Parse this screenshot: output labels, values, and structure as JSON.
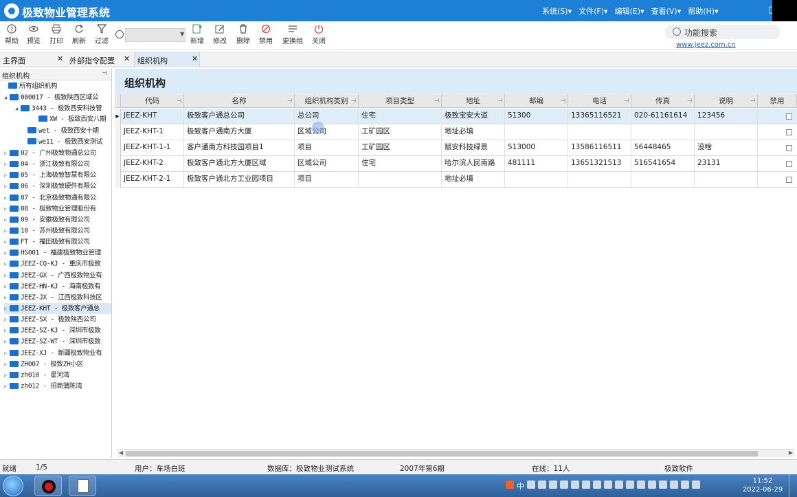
{
  "app": {
    "title": "极致物业管理系统"
  },
  "menus": [
    "系统(S)▾",
    "文件(F)▾",
    "编辑(E)▾",
    "查看(V)▾",
    "帮助(H)▾"
  ],
  "toolbar": {
    "help": "帮助",
    "preview": "预览",
    "print": "打印",
    "refresh": "刷新",
    "filter": "过滤",
    "new": "新增",
    "edit": "修改",
    "delete": "删除",
    "disable": "禁用",
    "change_group": "更换组",
    "close": "关闭"
  },
  "func_search": {
    "placeholder": "功能搜索",
    "link": "www.jeez.com.cn"
  },
  "tabs": [
    {
      "label": "主界面"
    },
    {
      "label": "外部指令配置"
    },
    {
      "label": "组织机构"
    }
  ],
  "tree": {
    "header": "组织机构",
    "items": [
      {
        "label": "所有组织机构"
      },
      {
        "label": "000017 - 极致陕西区域公"
      },
      {
        "label": "3443 - 极致西安科技管"
      },
      {
        "label": "XW - 极致西安八期"
      },
      {
        "label": "wet - 极致西安十期"
      },
      {
        "label": "we11 - 极致西安测试"
      },
      {
        "label": "02 - 广州极致物通总公司"
      },
      {
        "label": "04 - 浙江极致有限公司"
      },
      {
        "label": "05 - 上海极致智慧有限公"
      },
      {
        "label": "06 - 深圳极致硬件有限公"
      },
      {
        "label": "07 - 北京极致物通有限公"
      },
      {
        "label": "08 - 极致物业管理股份有"
      },
      {
        "label": "09 - 安徽极致有限公司"
      },
      {
        "label": "10 - 苏州极致有限公司"
      },
      {
        "label": "FT - 福田极致有限公司"
      },
      {
        "label": "HS001 - 福建极致物业管理"
      },
      {
        "label": "JEEZ-CQ-KJ - 重庆市极致"
      },
      {
        "label": "JEEZ-GX - 广西极致物业有"
      },
      {
        "label": "JEEZ-HN-KJ - 海南极致有"
      },
      {
        "label": "JEEZ-JX - 江西极致科技区"
      },
      {
        "label": "JEEZ-KHT - 极致客户通总"
      },
      {
        "label": "JEEZ-SX - 极致陕西公司"
      },
      {
        "label": "JEEZ-SZ-KJ - 深圳市极致"
      },
      {
        "label": "JEEZ-SZ-WT - 深圳市极致"
      },
      {
        "label": "JEEZ-XJ - 新疆极致物业有"
      },
      {
        "label": "ZH007 - 极致ZH小区"
      },
      {
        "label": "zh010 - 星河湾"
      },
      {
        "label": "zh012 - 招商蒲陈湾"
      }
    ]
  },
  "main": {
    "heading": "组织机构"
  },
  "grid": {
    "columns": [
      "代码",
      "名称",
      "组织机构类别",
      "项目类型",
      "地址",
      "邮编",
      "电话",
      "传真",
      "说明",
      "禁用"
    ],
    "rows": [
      [
        "JEEZ-KHT",
        "极致客户通总公司",
        "总公司",
        "住宅",
        "极致宝安大道",
        "51300",
        "13365116521",
        "020-61161614",
        "123456"
      ],
      [
        "JEEZ-KHT-1",
        "极致客户通南方大厦",
        "区域公司",
        "工矿园区",
        "地址必填",
        "",
        "",
        "",
        ""
      ],
      [
        "JEEZ-KHT-1-1",
        "客户通南方科技园项目1",
        "项目",
        "工矿园区",
        "赋安科技绿景",
        "513000",
        "13586116511",
        "56448465",
        "没啥"
      ],
      [
        "JEEZ-KHT-2",
        "极致客户通北方大厦区域",
        "区域公司",
        "住宅",
        "哈尔滨人民南路",
        "481111",
        "13651321513",
        "516541654",
        "23131"
      ],
      [
        "JEEZ-KHT-2-1",
        "极致客户通北方工业园项目",
        "项目",
        "",
        "地址必填",
        "",
        "",
        "",
        ""
      ]
    ]
  },
  "status": {
    "state": "就绪",
    "pages": "1/5",
    "user": "用户：车场白班",
    "db": "数据库：极致物业测试系统",
    "period": "2007年第6期",
    "online": "在线：11人",
    "vendor": "极致软件"
  },
  "taskbar": {
    "time": "11:52",
    "date": "2022-06-29",
    "ime": "中"
  }
}
